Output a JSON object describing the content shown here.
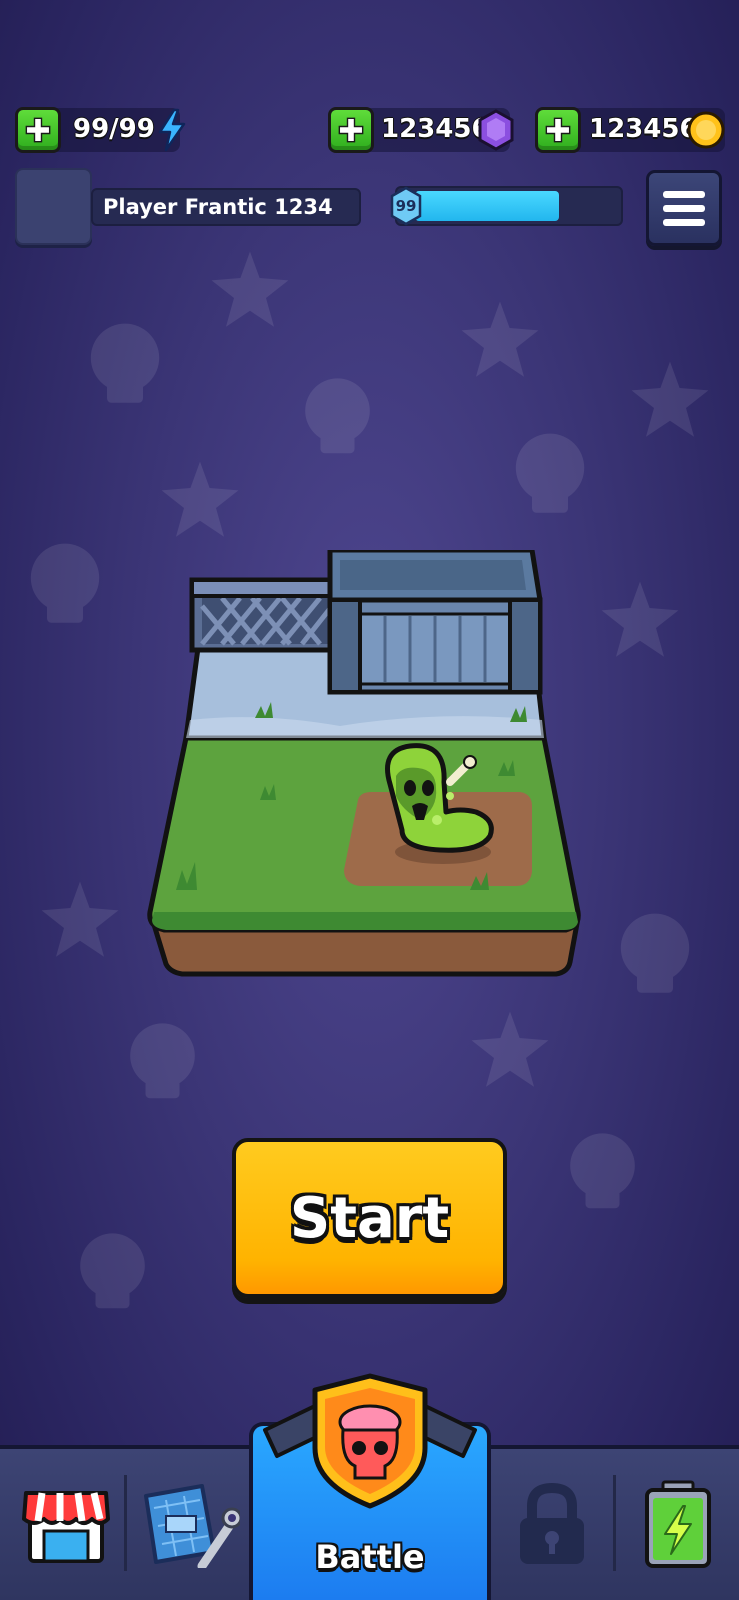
{
  "resources": {
    "energy": {
      "value": "99/99",
      "icon": "lightning-icon",
      "color": "#3ab4ff"
    },
    "gems": {
      "value": "123456",
      "icon": "gem-icon",
      "color": "#8b4fe0"
    },
    "coins": {
      "value": "123456",
      "icon": "coin-icon",
      "color": "#ffc21a"
    }
  },
  "player": {
    "name": "Player Frantic 1234",
    "level": "99",
    "xp_fraction": 0.72
  },
  "start_button": {
    "label": "Start",
    "color": "#ffb300"
  },
  "nav": {
    "items": [
      {
        "name": "shop",
        "icon": "shop-icon"
      },
      {
        "name": "workshop",
        "icon": "blueprint-wrench-icon"
      },
      {
        "name": "battle",
        "label": "Battle",
        "icon": "skull-shield-icon",
        "active": true
      },
      {
        "name": "locked",
        "icon": "lock-icon"
      },
      {
        "name": "energy",
        "icon": "battery-icon"
      }
    ]
  },
  "colors": {
    "background": "#3b3576",
    "accent_green": "#3fc72a",
    "battle_tab": "#1f8ff5"
  }
}
